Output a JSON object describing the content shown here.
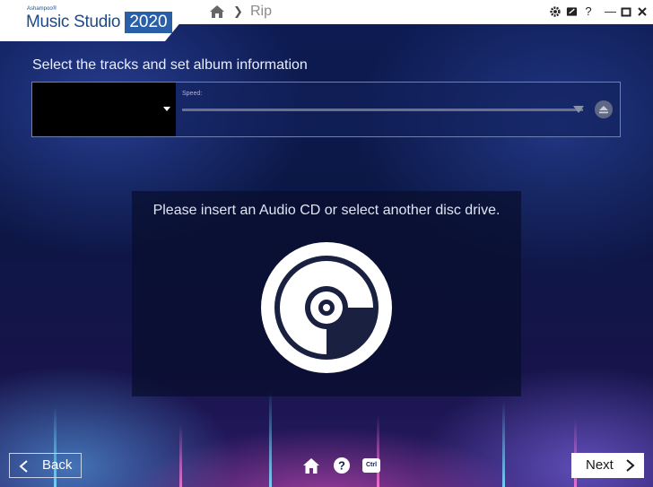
{
  "brand": {
    "company": "Ashampoo®",
    "product": "Music Studio",
    "year": "2020"
  },
  "nav": {
    "page": "Rip"
  },
  "instruction": "Select the tracks and set album information",
  "drive": {
    "speed_label": "Speed:"
  },
  "cd_message": "Please insert an Audio CD or select another disc drive.",
  "footer": {
    "back_label": "Back",
    "next_label": "Next",
    "ctrl_label": "Ctrl"
  },
  "icons": [
    "home-icon",
    "settings-icon",
    "help-icon",
    "minimize-icon",
    "maximize-icon",
    "close-icon",
    "eject-icon",
    "cd-icon"
  ]
}
